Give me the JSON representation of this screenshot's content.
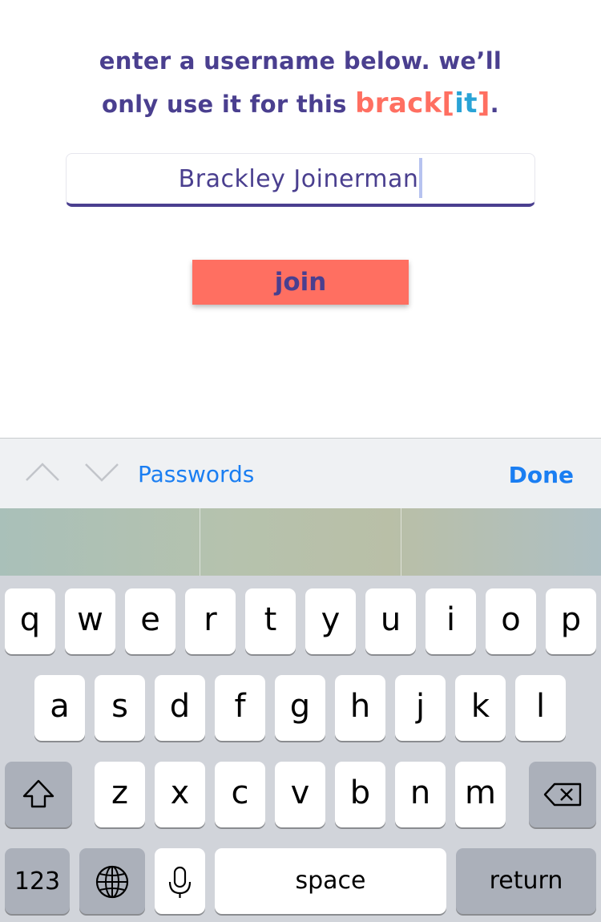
{
  "intro": {
    "line1": "enter a username below. we’ll",
    "line2_prefix": "only use it for this ",
    "brand_brack": "brack",
    "brand_open": "[",
    "brand_it": "it",
    "brand_close": "]",
    "line2_suffix": "."
  },
  "username": {
    "value": "Brackley Joinerman"
  },
  "join": {
    "label": "join"
  },
  "accessory": {
    "passwords_label": "Passwords",
    "done_label": "Done"
  },
  "keyboard": {
    "row1": [
      "q",
      "w",
      "e",
      "r",
      "t",
      "y",
      "u",
      "i",
      "o",
      "p"
    ],
    "row2": [
      "a",
      "s",
      "d",
      "f",
      "g",
      "h",
      "j",
      "k",
      "l"
    ],
    "row3": [
      "z",
      "x",
      "c",
      "v",
      "b",
      "n",
      "m"
    ],
    "numbers_label": "123",
    "space_label": "space",
    "return_label": "return"
  },
  "colors": {
    "brand_purple": "#4a3f8f",
    "brand_coral": "#ff6f61",
    "brand_blue": "#29a3d6",
    "ios_blue": "#1a7ef2"
  }
}
